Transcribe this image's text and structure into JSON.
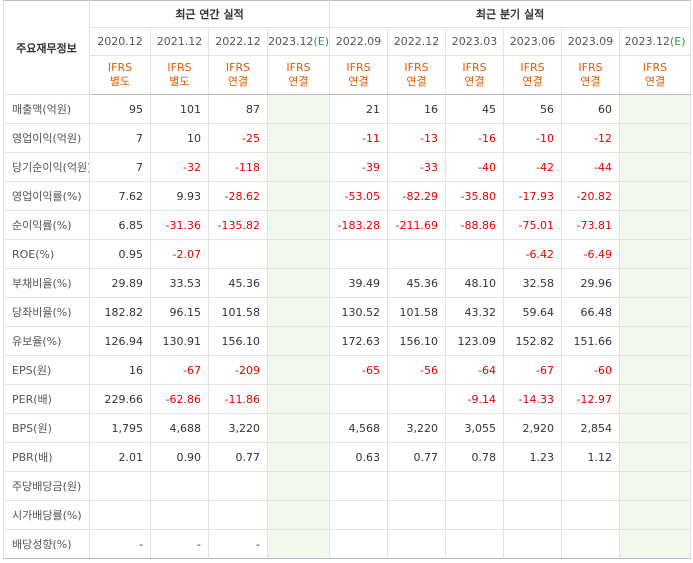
{
  "header": {
    "corner": "주요재무정보",
    "annual_title": "최근 연간 실적",
    "quarterly_title": "최근 분기 실적",
    "annual_periods": [
      {
        "label": "2020.12",
        "std": "IFRS",
        "basis": "별도"
      },
      {
        "label": "2021.12",
        "std": "IFRS",
        "basis": "별도"
      },
      {
        "label": "2022.12",
        "std": "IFRS",
        "basis": "연결"
      },
      {
        "label": "2023.12",
        "est": "(E)",
        "std": "IFRS",
        "basis": "연결"
      }
    ],
    "quarterly_periods": [
      {
        "label": "2022.09",
        "std": "IFRS",
        "basis": "연결"
      },
      {
        "label": "2022.12",
        "std": "IFRS",
        "basis": "연결"
      },
      {
        "label": "2023.03",
        "std": "IFRS",
        "basis": "연결"
      },
      {
        "label": "2023.06",
        "std": "IFRS",
        "basis": "연결"
      },
      {
        "label": "2023.09",
        "std": "IFRS",
        "basis": "연결"
      },
      {
        "label": "2023.12",
        "est": "(E)",
        "std": "IFRS",
        "basis": "연결"
      }
    ]
  },
  "rows": [
    {
      "label": "매출액(억원)",
      "annual": [
        "95",
        "101",
        "87",
        ""
      ],
      "quarterly": [
        "21",
        "16",
        "45",
        "56",
        "60",
        ""
      ]
    },
    {
      "label": "영업이익(억원)",
      "annual": [
        "7",
        "10",
        "-25",
        ""
      ],
      "quarterly": [
        "-11",
        "-13",
        "-16",
        "-10",
        "-12",
        ""
      ]
    },
    {
      "label": "당기순이익(억원)",
      "annual": [
        "7",
        "-32",
        "-118",
        ""
      ],
      "quarterly": [
        "-39",
        "-33",
        "-40",
        "-42",
        "-44",
        ""
      ]
    },
    {
      "label": "영업이익률(%)",
      "annual": [
        "7.62",
        "9.93",
        "-28.62",
        ""
      ],
      "quarterly": [
        "-53.05",
        "-82.29",
        "-35.80",
        "-17.93",
        "-20.82",
        ""
      ]
    },
    {
      "label": "순이익률(%)",
      "annual": [
        "6.85",
        "-31.36",
        "-135.82",
        ""
      ],
      "quarterly": [
        "-183.28",
        "-211.69",
        "-88.86",
        "-75.01",
        "-73.81",
        ""
      ]
    },
    {
      "label": "ROE(%)",
      "annual": [
        "0.95",
        "-2.07",
        "",
        ""
      ],
      "quarterly": [
        "",
        "",
        "",
        "-6.42",
        "-6.49",
        ""
      ]
    },
    {
      "label": "부채비율(%)",
      "annual": [
        "29.89",
        "33.53",
        "45.36",
        ""
      ],
      "quarterly": [
        "39.49",
        "45.36",
        "48.10",
        "32.58",
        "29.96",
        ""
      ]
    },
    {
      "label": "당좌비율(%)",
      "annual": [
        "182.82",
        "96.15",
        "101.58",
        ""
      ],
      "quarterly": [
        "130.52",
        "101.58",
        "43.32",
        "59.64",
        "66.48",
        ""
      ]
    },
    {
      "label": "유보율(%)",
      "annual": [
        "126.94",
        "130.91",
        "156.10",
        ""
      ],
      "quarterly": [
        "172.63",
        "156.10",
        "123.09",
        "152.82",
        "151.66",
        ""
      ]
    },
    {
      "label": "EPS(원)",
      "annual": [
        "16",
        "-67",
        "-209",
        ""
      ],
      "quarterly": [
        "-65",
        "-56",
        "-64",
        "-67",
        "-60",
        ""
      ]
    },
    {
      "label": "PER(배)",
      "annual": [
        "229.66",
        "-62.86",
        "-11.86",
        ""
      ],
      "quarterly": [
        "",
        "",
        "-9.14",
        "-14.33",
        "-12.97",
        ""
      ]
    },
    {
      "label": "BPS(원)",
      "annual": [
        "1,795",
        "4,688",
        "3,220",
        ""
      ],
      "quarterly": [
        "4,568",
        "3,220",
        "3,055",
        "2,920",
        "2,854",
        ""
      ]
    },
    {
      "label": "PBR(배)",
      "annual": [
        "2.01",
        "0.90",
        "0.77",
        ""
      ],
      "quarterly": [
        "0.63",
        "0.77",
        "0.78",
        "1.23",
        "1.12",
        ""
      ]
    },
    {
      "label": "주당배당금(원)",
      "annual": [
        "",
        "",
        "",
        ""
      ],
      "quarterly": [
        "",
        "",
        "",
        "",
        "",
        ""
      ]
    },
    {
      "label": "시가배당률(%)",
      "annual": [
        "",
        "",
        "",
        ""
      ],
      "quarterly": [
        "",
        "",
        "",
        "",
        "",
        ""
      ]
    },
    {
      "label": "배당성향(%)",
      "annual": [
        "-",
        "-",
        "-",
        ""
      ],
      "quarterly": [
        "",
        "",
        "",
        "",
        "",
        ""
      ]
    }
  ]
}
